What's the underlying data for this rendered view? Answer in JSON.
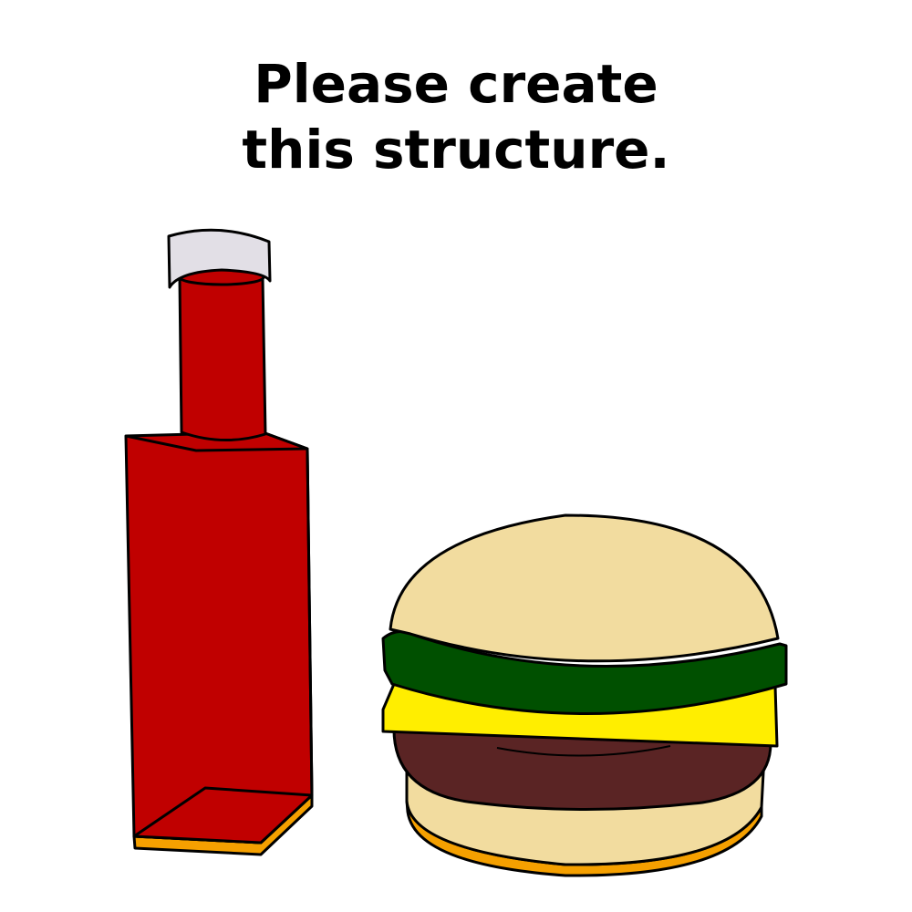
{
  "instruction": {
    "line1": "Please create",
    "line2": "this structure."
  },
  "colors": {
    "background": "#ffffff",
    "outline": "#000000",
    "bottle_red": "#c00000",
    "bottle_cap": "#e2dfe6",
    "bottle_base": "#f5a000",
    "bun": "#f2dc9f",
    "lettuce": "#005000",
    "cheese": "#ffee00",
    "patty": "#5a2424",
    "bun_base": "#f5a000"
  },
  "objects": [
    {
      "name": "ketchup-bottle",
      "icon": "ketchup-bottle-icon"
    },
    {
      "name": "hamburger",
      "icon": "hamburger-icon"
    }
  ]
}
